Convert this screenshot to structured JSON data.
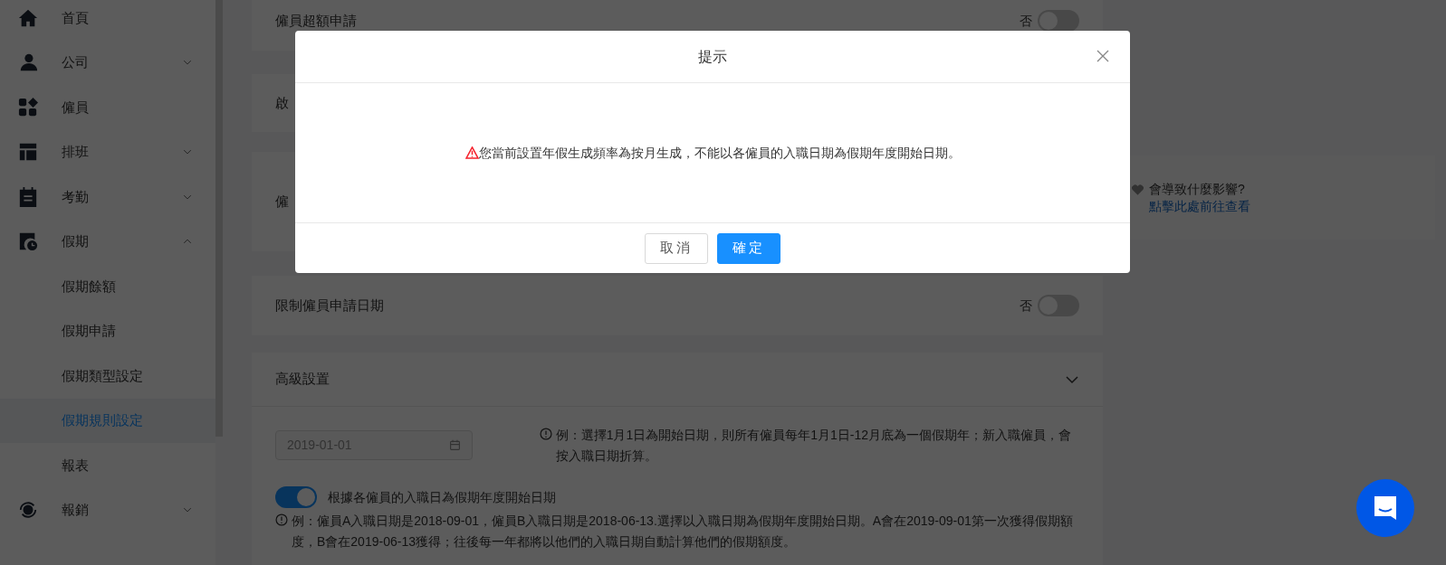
{
  "sidebar": {
    "items": [
      {
        "label": "首頁",
        "selected": false
      },
      {
        "label": "公司",
        "selected": false,
        "expanded": false
      },
      {
        "label": "僱員",
        "selected": false
      },
      {
        "label": "排班",
        "selected": false,
        "expanded": false
      },
      {
        "label": "考勤",
        "selected": false,
        "expanded": false
      },
      {
        "label": "假期",
        "selected": false,
        "expanded": true,
        "children": [
          {
            "label": "假期餘額",
            "selected": false
          },
          {
            "label": "假期申請",
            "selected": false
          },
          {
            "label": "假期類型設定",
            "selected": false
          },
          {
            "label": "假期規則設定",
            "selected": true
          },
          {
            "label": "報表",
            "selected": false
          }
        ]
      },
      {
        "label": "報銷",
        "selected": false,
        "expanded": false
      }
    ]
  },
  "settings": [
    {
      "title": "僱員超額申請",
      "switch_label": "否",
      "on": false
    },
    {
      "title": "啟"
    },
    {
      "title": "僱"
    },
    {
      "title": "限制僱員申請日期",
      "switch_label": "否",
      "on": false
    }
  ],
  "advanced": {
    "title": "高級設置",
    "expanded": true,
    "date_field": {
      "value": "2019-01-01",
      "disabled": true
    },
    "date_note": "例：選擇1月1日為開始日期，則所有僱員每年1月1日-12月底為一個假期年；新入職僱員，會按入職日期折算。",
    "hire_date_switch": {
      "label": "根據各僱員的入職日為假期年度開始日期",
      "on": true
    },
    "hire_date_note": "例：僱員A入職日期是2018-09-01，僱員B入職日期是2018-06-13.選擇以入職日期為假期年度開始日期。A會在2019-09-01第一次獲得假期額度，B會在2019-06-13獲得；往後每一年都將以他們的入職日期自動計算他們的假期額度。"
  },
  "hint": {
    "question": "會導致什麼影響?",
    "link": "點擊此處前往查看"
  },
  "dialog": {
    "title": "提示",
    "message": "您當前設置年假生成頻率為按月生成，不能以各僱員的入職日期為假期年度開始日期。",
    "buttons": [
      {
        "label": "取消",
        "kind": "secondary"
      },
      {
        "label": "確定",
        "kind": "primary"
      }
    ]
  }
}
